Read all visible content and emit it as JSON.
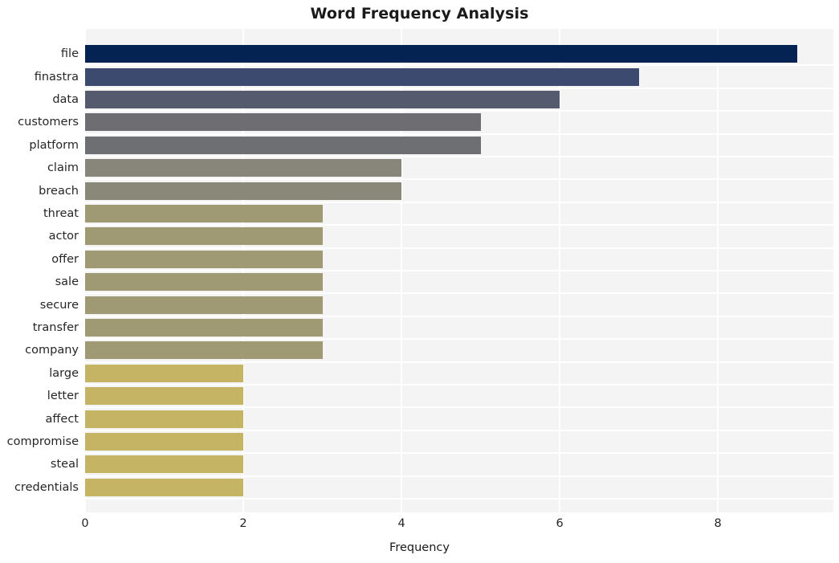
{
  "chart_data": {
    "type": "bar",
    "orientation": "horizontal",
    "title": "Word Frequency Analysis",
    "xlabel": "Frequency",
    "ylabel": "",
    "categories": [
      "file",
      "finastra",
      "data",
      "customers",
      "platform",
      "claim",
      "breach",
      "threat",
      "actor",
      "offer",
      "sale",
      "secure",
      "transfer",
      "company",
      "large",
      "letter",
      "affect",
      "compromise",
      "steal",
      "credentials"
    ],
    "values": [
      9,
      7,
      6,
      5,
      5,
      4,
      4,
      3,
      3,
      3,
      3,
      3,
      3,
      3,
      2,
      2,
      2,
      2,
      2,
      2
    ],
    "bar_colors": [
      "#042352",
      "#3b4a6e",
      "#565a6e",
      "#6e6e72",
      "#6e6f73",
      "#88867a",
      "#8a8878",
      "#a09a74",
      "#a09a74",
      "#a09a74",
      "#a09a74",
      "#a09a74",
      "#a09a74",
      "#a09a74",
      "#c4b464",
      "#c4b464",
      "#c4b464",
      "#c4b464",
      "#c4b464",
      "#c4b464"
    ],
    "xticks": [
      0,
      2,
      4,
      6,
      8
    ],
    "xtick_labels": [
      "0",
      "2",
      "4",
      "6",
      "8"
    ],
    "xlim": [
      0,
      9.46
    ],
    "grid": true,
    "legend": null,
    "plot_background": "#f4f4f5",
    "grid_color": "#ffffff",
    "figure_background": "#ffffff",
    "text_color": "#262626"
  }
}
